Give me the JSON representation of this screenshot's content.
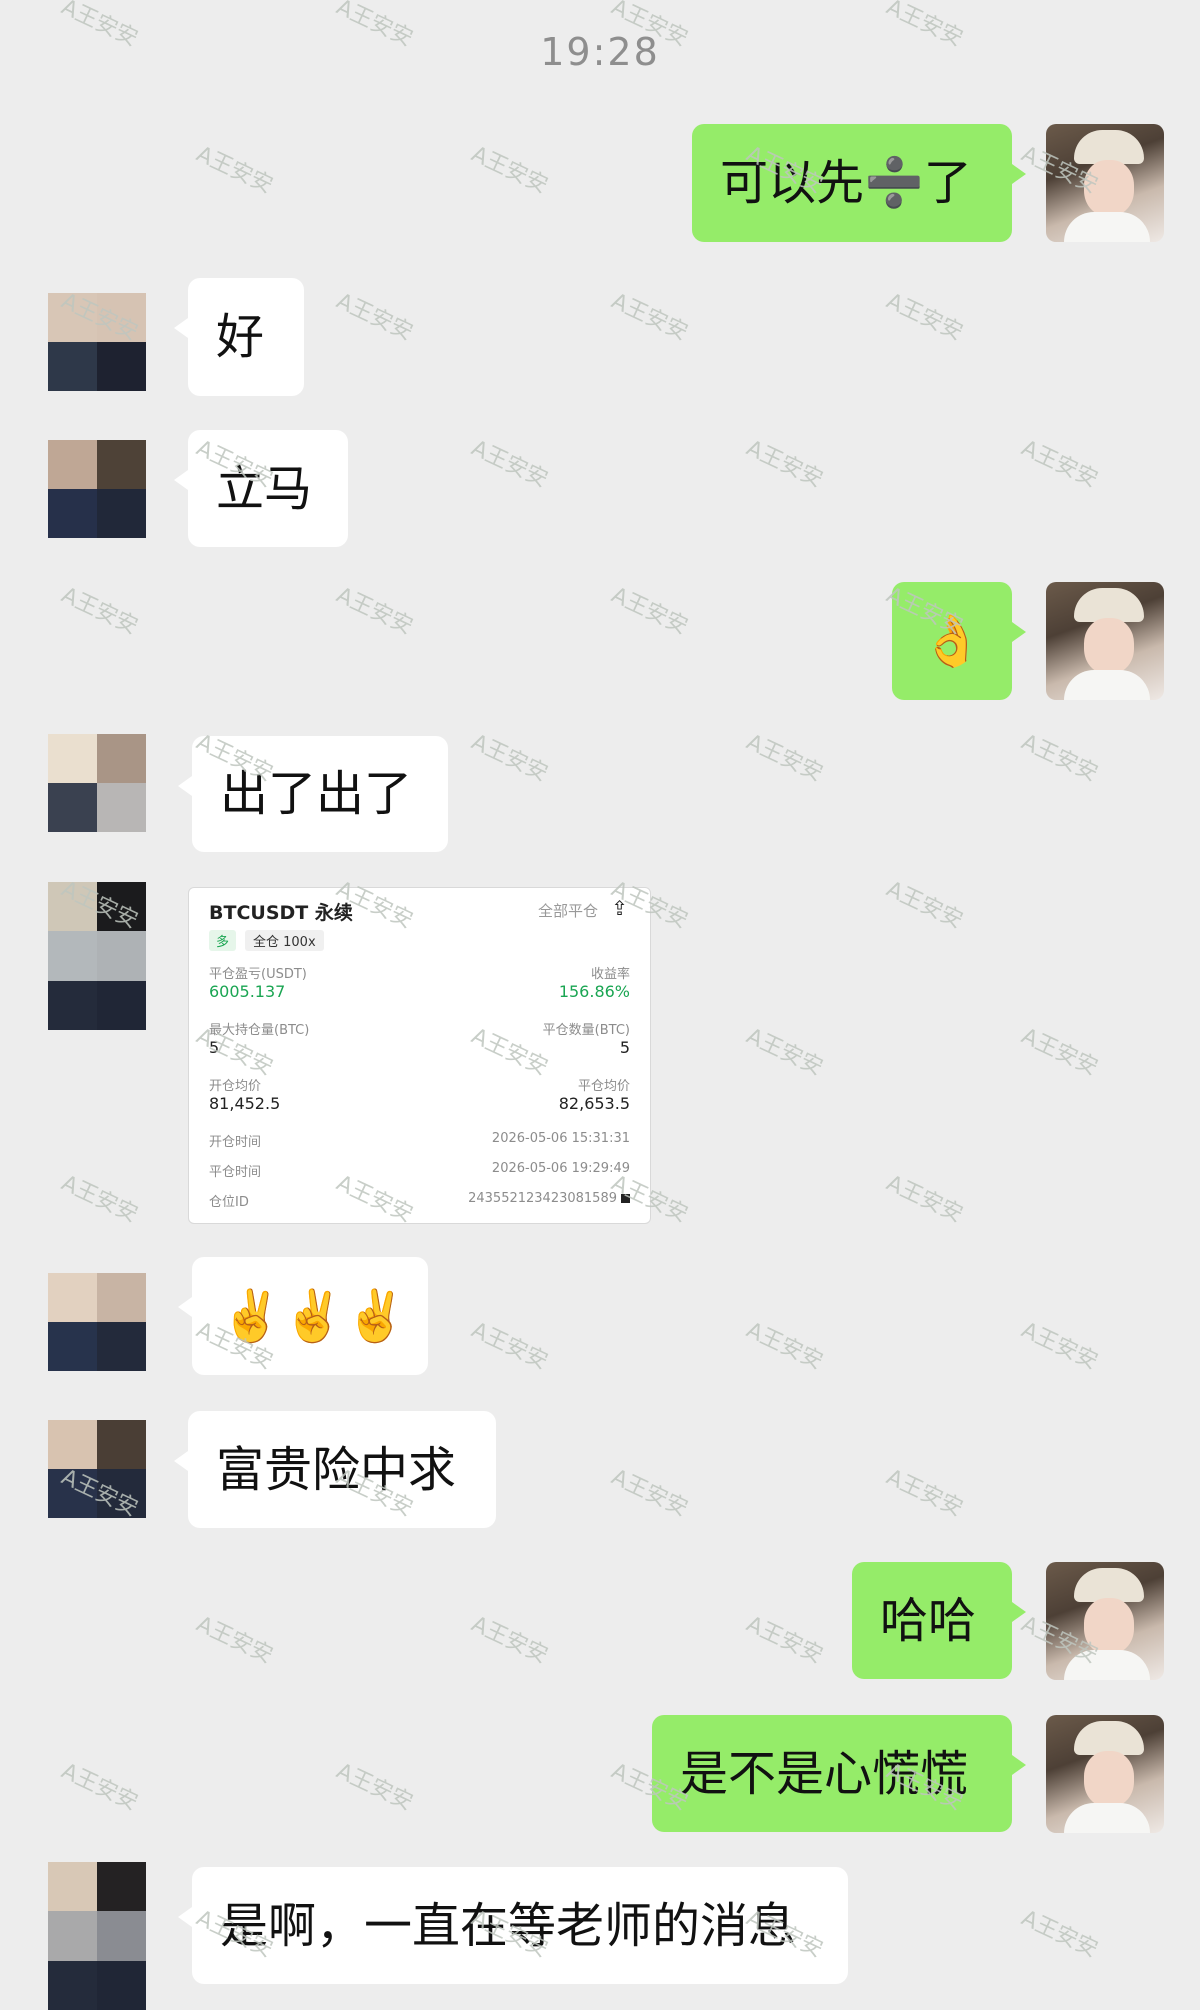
{
  "status": {
    "time": "19:28"
  },
  "messages": [
    {
      "side": "right",
      "text": "可以先➗了"
    },
    {
      "side": "left",
      "text": "好"
    },
    {
      "side": "left",
      "text": "立马"
    },
    {
      "side": "right",
      "text": "👌"
    },
    {
      "side": "left",
      "text": "出了出了"
    },
    {
      "side": "left",
      "type": "image"
    },
    {
      "side": "left",
      "text": "✌️✌️✌️"
    },
    {
      "side": "left",
      "text": "富贵险中求"
    },
    {
      "side": "right",
      "text": "哈哈"
    },
    {
      "side": "right",
      "text": "是不是心慌慌"
    },
    {
      "side": "left",
      "text": "是啊，一直在等老师的消息"
    }
  ],
  "trade_card": {
    "title": "BTCUSDT 永续",
    "close_all": "全部平仓",
    "share_icon": "share-icon",
    "tag_direction": "多",
    "tag_margin": "全仓 100x",
    "pnl_label": "平仓盈亏(USDT)",
    "pnl_value": "6005.137",
    "roi_label": "收益率",
    "roi_value": "156.86%",
    "max_pos_label": "最大持仓量(BTC)",
    "max_pos_value": "5",
    "close_qty_label": "平仓数量(BTC)",
    "close_qty_value": "5",
    "open_avg_label": "开仓均价",
    "open_avg_value": "81,452.5",
    "close_avg_label": "平仓均价",
    "close_avg_value": "82,653.5",
    "open_time_label": "开仓时间",
    "open_time_value": "2026-05-06 15:31:31",
    "close_time_label": "平仓时间",
    "close_time_value": "2026-05-06 19:29:49",
    "pos_id_label": "仓位ID",
    "pos_id_value": "243552123423081589"
  },
  "watermark": {
    "text": "A王安安"
  },
  "colors": {
    "background": "#ededed",
    "sent_bubble": "#95ec69",
    "received_bubble": "#ffffff",
    "profit_green": "#1aa552"
  }
}
